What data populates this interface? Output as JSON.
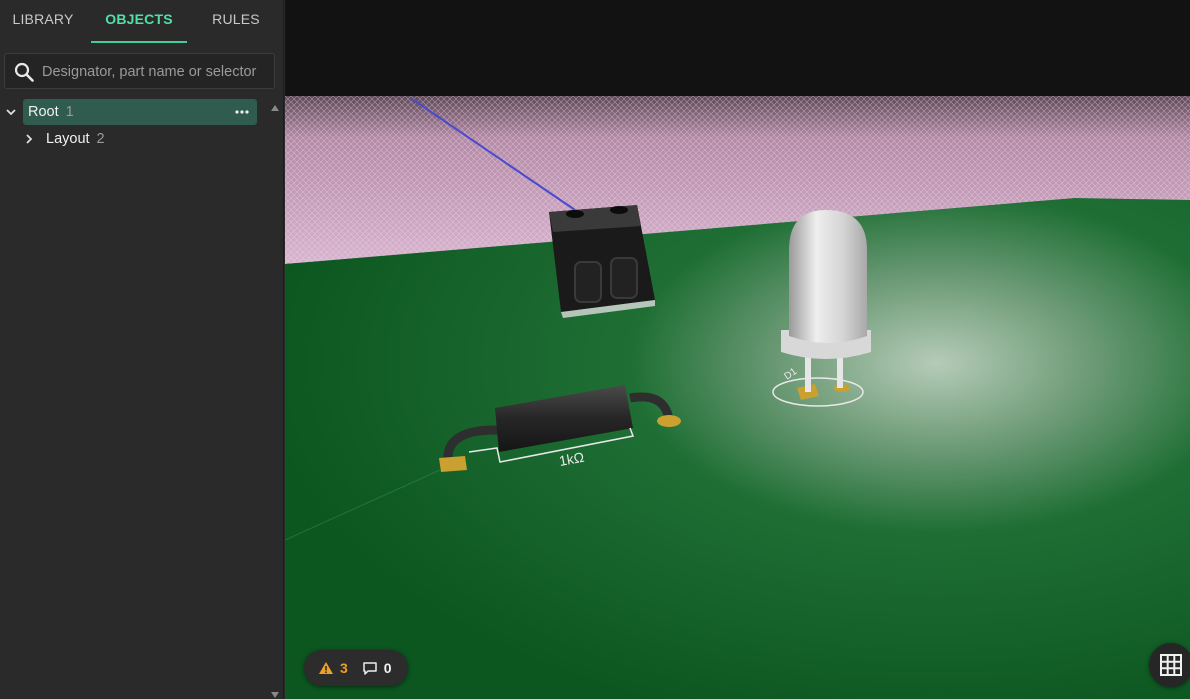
{
  "sidebar": {
    "tabs": [
      {
        "label": "LIBRARY",
        "active": false
      },
      {
        "label": "OBJECTS",
        "active": true
      },
      {
        "label": "RULES",
        "active": false
      }
    ],
    "search": {
      "placeholder": "Designator, part name or selector",
      "value": ""
    },
    "tree": [
      {
        "label": "Root",
        "count": "1",
        "expanded": true,
        "selected": true
      },
      {
        "label": "Layout",
        "count": "2",
        "expanded": false,
        "selected": false
      }
    ]
  },
  "viewport": {
    "resistor_label": "1kΩ",
    "led_label": "D1",
    "status": {
      "warnings": "3",
      "comments": "0"
    }
  },
  "colors": {
    "accent": "#4fe0a8",
    "selected_row": "#2f5c4f",
    "board": "#0e5a24",
    "warning": "#f0a020"
  },
  "icons": [
    "search-icon",
    "chevron-down-icon",
    "chevron-right-icon",
    "more-icon",
    "warning-icon",
    "comment-icon",
    "grid-icon"
  ]
}
